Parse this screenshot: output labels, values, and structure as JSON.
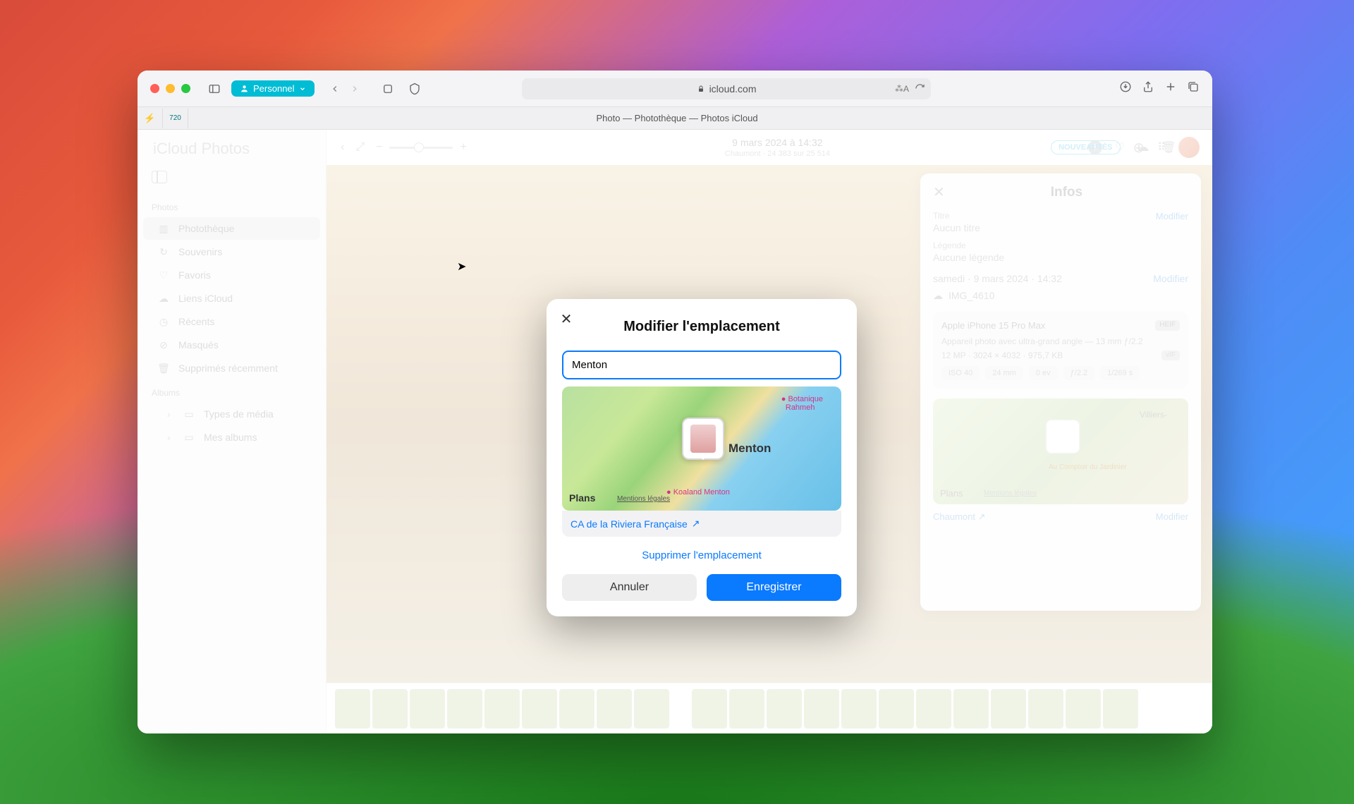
{
  "browser": {
    "profile_label": "Personnel",
    "url_display": "icloud.com",
    "tab_title": "Photo — Photothèque — Photos iCloud"
  },
  "app": {
    "title_prefix": "iCloud",
    "title_suffix": "Photos",
    "news_badge": "NOUVEAUTÉS"
  },
  "sidebar": {
    "section_photos": "Photos",
    "items": [
      {
        "label": "Photothèque"
      },
      {
        "label": "Souvenirs"
      },
      {
        "label": "Favoris"
      },
      {
        "label": "Liens iCloud"
      },
      {
        "label": "Récents"
      },
      {
        "label": "Masqués"
      },
      {
        "label": "Supprimés récemment"
      }
    ],
    "section_albums": "Albums",
    "albums": [
      {
        "label": "Types de média"
      },
      {
        "label": "Mes albums"
      }
    ]
  },
  "viewer": {
    "date": "9 mars 2024 à 14:32",
    "location_count": "Chaumont · 24 383 sur 25 514"
  },
  "info_panel": {
    "title": "Infos",
    "titre_label": "Titre",
    "titre_value": "Aucun titre",
    "legende_label": "Légende",
    "legende_value": "Aucune légende",
    "modifier_link": "Modifier",
    "datetime": "samedi · 9 mars 2024 · 14:32",
    "filename": "IMG_4610",
    "device": "Apple iPhone 15 Pro Max",
    "device_badge": "HEIF",
    "lens": "Appareil photo avec ultra-grand angle — 13 mm ƒ/2.2",
    "resolution": "12 MP · 3024 × 4032 · 975,7 KB",
    "format_badge": "vIF",
    "stats": [
      "ISO 40",
      "24 mm",
      "0 ev",
      "ƒ/2.2",
      "1/269 s"
    ],
    "map_place": "Villiers-",
    "map_poi": "Au Comptoir du Jardinier",
    "map_brand": "Plans",
    "map_legal": "Mentions légales",
    "location": "Chaumont",
    "modifier2": "Modifier"
  },
  "modal": {
    "title": "Modifier l'emplacement",
    "input_value": "Menton",
    "map_city": "Menton",
    "map_poi1_line1": "Botanique",
    "map_poi1_line2": "Rahmeh",
    "map_poi2": "Koaland Menton",
    "map_brand": "Plans",
    "map_legal": "Mentions légales",
    "suggestion": "CA de la Riviera Française",
    "delete_link": "Supprimer l'emplacement",
    "cancel": "Annuler",
    "save": "Enregistrer"
  }
}
